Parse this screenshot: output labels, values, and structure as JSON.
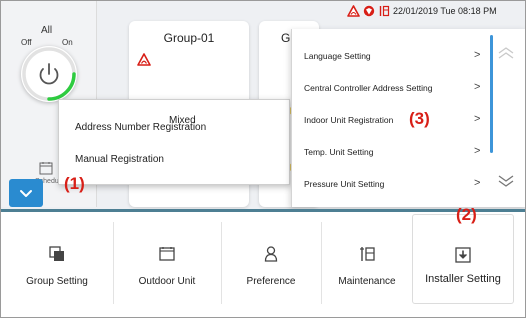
{
  "status_bar": {
    "datetime": "22/01/2019 Tue 08:18 PM",
    "icons": [
      "warning-icon",
      "shield-icon",
      "tools-icon"
    ]
  },
  "left_panel": {
    "all_label": "All",
    "off_label": "Off",
    "on_label": "On",
    "schedule_label": "Schedule"
  },
  "groups": [
    {
      "title": "Group-01",
      "mode": "Mixed"
    },
    {
      "title": "G"
    }
  ],
  "registration_popup": {
    "items": [
      "Address Number Registration",
      "Manual Registration"
    ]
  },
  "installer_popup": {
    "items": [
      {
        "label": "Language Setting",
        "arrow": ">"
      },
      {
        "label": "Central Controller Address Setting",
        "arrow": ">"
      },
      {
        "label": "Indoor Unit Registration",
        "arrow": ">"
      },
      {
        "label": "Temp. Unit Setting",
        "arrow": ">"
      },
      {
        "label": "Pressure Unit Setting",
        "arrow": ">"
      }
    ]
  },
  "bottom_menu": {
    "items": [
      {
        "label": "Group Setting",
        "icon": "group-setting-icon"
      },
      {
        "label": "Outdoor Unit",
        "icon": "outdoor-unit-icon"
      },
      {
        "label": "Preference",
        "icon": "preference-icon"
      },
      {
        "label": "Maintenance",
        "icon": "maintenance-icon"
      },
      {
        "label": "Installer Setting",
        "icon": "installer-setting-icon"
      }
    ]
  },
  "annotations": [
    "(1)",
    "(2)",
    "(3)"
  ],
  "colors": {
    "accent_blue": "#2a8bd0",
    "annotation_red": "#d81f17",
    "power_green": "#2ecc40",
    "teal_rule": "#4d7f93"
  }
}
